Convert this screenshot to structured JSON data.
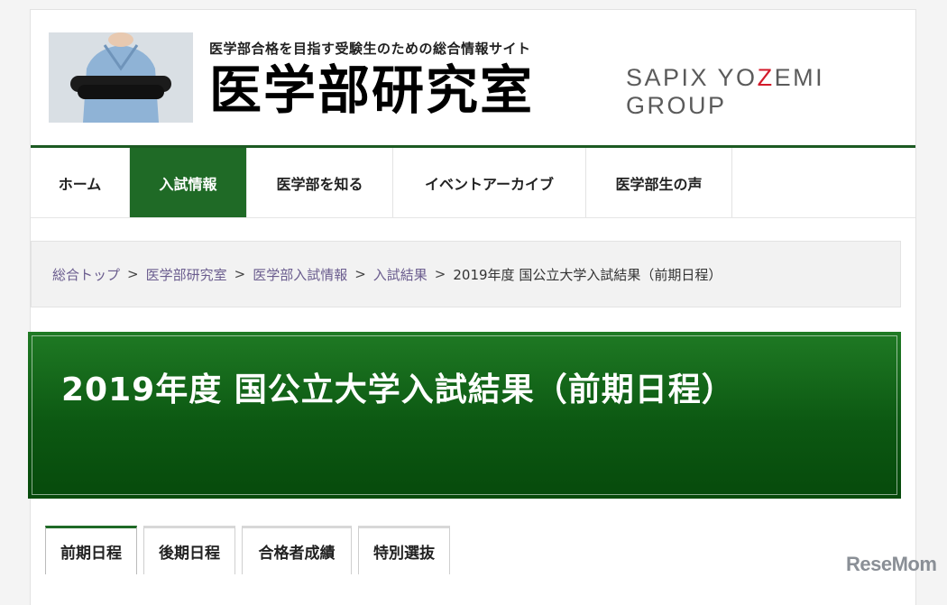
{
  "header": {
    "tagline": "医学部合格を目指す受験生のための総合情報サイト",
    "site_title": "医学部研究室",
    "brand_part1": "SAPIX YO",
    "brand_accent": "Z",
    "brand_part2": "EMI GROUP",
    "photo_icon": "doctor-arms-crossed-photo"
  },
  "nav": {
    "items": [
      {
        "label": "ホーム"
      },
      {
        "label": "入試情報"
      },
      {
        "label": "医学部を知る"
      },
      {
        "label": "イベントアーカイブ"
      },
      {
        "label": "医学部生の声"
      }
    ]
  },
  "breadcrumb": {
    "items": [
      "総合トップ",
      "医学部研究室",
      "医学部入試情報",
      "入試結果"
    ],
    "separator": ">",
    "current": "2019年度 国公立大学入試結果（前期日程）"
  },
  "banner": {
    "title": "2019年度 国公立大学入試結果（前期日程）"
  },
  "tabs": {
    "items": [
      {
        "label": "前期日程"
      },
      {
        "label": "後期日程"
      },
      {
        "label": "合格者成績"
      },
      {
        "label": "特別選抜"
      }
    ]
  },
  "watermark": "ReseMom",
  "colors": {
    "accent_green": "#1f6a26",
    "brand_red": "#d31a2a",
    "breadcrumb_link": "#6a5c8e"
  }
}
